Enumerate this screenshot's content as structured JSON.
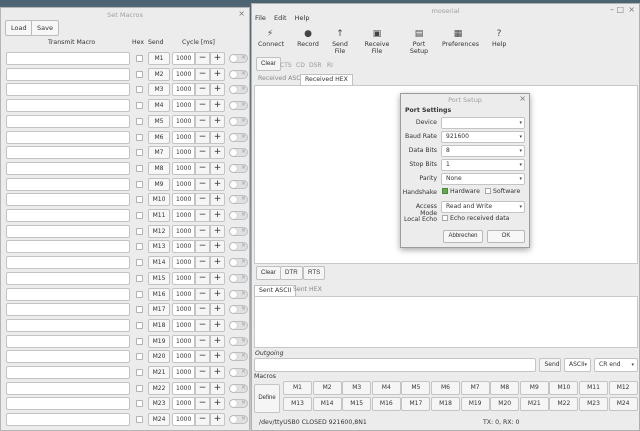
{
  "macros_window": {
    "title": "Set Macros",
    "load_label": "Load",
    "save_label": "Save",
    "close_glyph": "×",
    "col_transmit": "Transmit Macro",
    "col_hex": "Hex",
    "col_send": "Send",
    "col_cycle": "Cycle [ms]",
    "rows": [
      {
        "send": "M1",
        "cycle": "1000"
      },
      {
        "send": "M2",
        "cycle": "1000"
      },
      {
        "send": "M3",
        "cycle": "1000"
      },
      {
        "send": "M4",
        "cycle": "1000"
      },
      {
        "send": "M5",
        "cycle": "1000"
      },
      {
        "send": "M6",
        "cycle": "1000"
      },
      {
        "send": "M7",
        "cycle": "1000"
      },
      {
        "send": "M8",
        "cycle": "1000"
      },
      {
        "send": "M9",
        "cycle": "1000"
      },
      {
        "send": "M10",
        "cycle": "1000"
      },
      {
        "send": "M11",
        "cycle": "1000"
      },
      {
        "send": "M12",
        "cycle": "1000"
      },
      {
        "send": "M13",
        "cycle": "1000"
      },
      {
        "send": "M14",
        "cycle": "1000"
      },
      {
        "send": "M15",
        "cycle": "1000"
      },
      {
        "send": "M16",
        "cycle": "1000"
      },
      {
        "send": "M17",
        "cycle": "1000"
      },
      {
        "send": "M18",
        "cycle": "1000"
      },
      {
        "send": "M19",
        "cycle": "1000"
      },
      {
        "send": "M20",
        "cycle": "1000"
      },
      {
        "send": "M21",
        "cycle": "1000"
      },
      {
        "send": "M22",
        "cycle": "1000"
      },
      {
        "send": "M23",
        "cycle": "1000"
      },
      {
        "send": "M24",
        "cycle": "1000"
      }
    ]
  },
  "main_window": {
    "title": "moserial",
    "menu": [
      "File",
      "Edit",
      "Help"
    ],
    "toolbar": [
      {
        "label": "Connect",
        "icon": "connect-icon"
      },
      {
        "label": "Record",
        "icon": "record-icon"
      },
      {
        "label": "Send File",
        "icon": "send-file-icon"
      },
      {
        "label": "Receive File",
        "icon": "receive-file-icon"
      },
      {
        "label": "Port Setup",
        "icon": "port-setup-icon"
      },
      {
        "label": "Preferences",
        "icon": "preferences-icon"
      },
      {
        "label": "Help",
        "icon": "help-icon"
      }
    ],
    "clear_label": "Clear",
    "signals": [
      "CTS",
      "CD",
      "DSR",
      "RI"
    ],
    "received_tabs": [
      "Received ASCII",
      "Received HEX"
    ],
    "sent_controls": [
      "Clear",
      "DTR",
      "RTS"
    ],
    "sent_tabs": [
      "Sent ASCII",
      "Sent HEX"
    ],
    "outgoing_label": "Outgoing",
    "send_label": "Send",
    "ascii_option": "ASCII",
    "line_end_option": "CR end",
    "macros_label": "Macros",
    "define_label": "Define",
    "macro_buttons_row1": [
      "M1",
      "M2",
      "M3",
      "M4",
      "M5",
      "M6",
      "M7",
      "M8",
      "M9",
      "M10",
      "M11",
      "M12"
    ],
    "macro_buttons_row2": [
      "M13",
      "M14",
      "M15",
      "M16",
      "M17",
      "M18",
      "M19",
      "M20",
      "M21",
      "M22",
      "M23",
      "M24"
    ],
    "status_left": "/dev/ttyUSB0 CLOSED 921600,8N1",
    "status_right": "TX: 0, RX: 0"
  },
  "port_setup": {
    "title": "Port Setup",
    "section": "Port Settings",
    "device_label": "Device",
    "device_value": "",
    "baud_label": "Baud Rate",
    "baud_value": "921600",
    "data_bits_label": "Data Bits",
    "data_bits_value": "8",
    "stop_bits_label": "Stop Bits",
    "stop_bits_value": "1",
    "parity_label": "Parity",
    "parity_value": "None",
    "handshake_label": "Handshake",
    "hardware_label": "Hardware",
    "software_label": "Software",
    "access_label": "Access Mode",
    "access_value": "Read and Write",
    "echo_label": "Local Echo",
    "echo_option": "Echo received data",
    "abbrechen_label": "Abbrechen",
    "ok_label": "OK"
  }
}
